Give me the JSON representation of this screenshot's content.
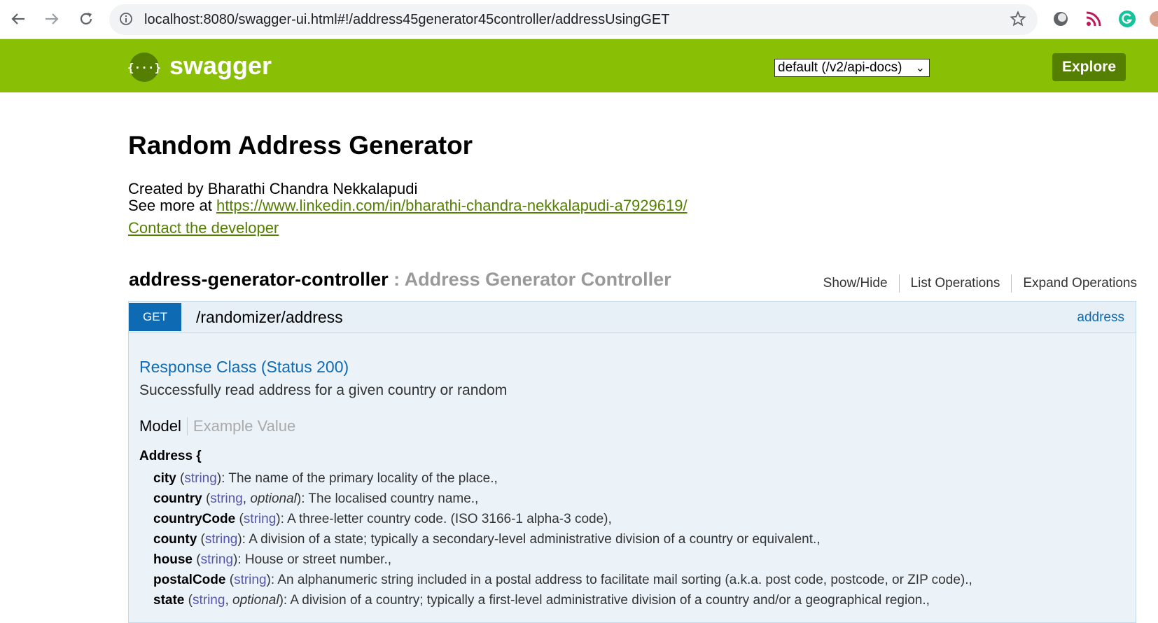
{
  "browser": {
    "url": "localhost:8080/swagger-ui.html#!/address45generator45controller/addressUsingGET"
  },
  "header": {
    "logo_mark": "{···}",
    "logo_text": "swagger",
    "spec_select": "default (/v2/api-docs)",
    "explore_label": "Explore"
  },
  "info": {
    "title": "Random Address Generator",
    "created_by": "Created by Bharathi Chandra Nekkalapudi",
    "see_more_prefix": "See more at ",
    "linkedin_url": "https://www.linkedin.com/in/bharathi-chandra-nekkalapudi-a7929619/",
    "contact": "Contact the developer"
  },
  "resource": {
    "name": "address-generator-controller",
    "description": " : Address Generator Controller",
    "show_hide": "Show/Hide",
    "list_operations": "List Operations",
    "expand_operations": "Expand Operations"
  },
  "operation": {
    "method": "GET",
    "path": "/randomizer/address",
    "summary": "address",
    "response_class": "Response Class (Status 200)",
    "response_message": "Successfully read address for a given country or random",
    "model_tab": "Model",
    "example_tab": "Example Value",
    "model_name": "Address {",
    "properties": [
      {
        "name": "city",
        "type": "string",
        "optional": "",
        "desc": "): The name of the primary locality of the place.,"
      },
      {
        "name": "country",
        "type": "string",
        "optional": "optional",
        "desc": "): The localised country name.,"
      },
      {
        "name": "countryCode",
        "type": "string",
        "optional": "",
        "desc": "): A three-letter country code. (ISO 3166-1 alpha-3 code),"
      },
      {
        "name": "county",
        "type": "string",
        "optional": "",
        "desc": "): A division of a state; typically a secondary-level administrative division of a country or equivalent.,"
      },
      {
        "name": "house",
        "type": "string",
        "optional": "",
        "desc": "): House or street number.,"
      },
      {
        "name": "postalCode",
        "type": "string",
        "optional": "",
        "desc": "): An alphanumeric string included in a postal address to facilitate mail sorting (a.k.a. post code, postcode, or ZIP code).,"
      },
      {
        "name": "state",
        "type": "string",
        "optional": "optional",
        "desc": "): A division of a country; typically a first-level administrative division of a country and/or a geographical region.,"
      }
    ]
  },
  "colors": {
    "swagger_green": "#89bf04",
    "swagger_dark_green": "#547f00",
    "get_blue": "#0f6ab4"
  }
}
